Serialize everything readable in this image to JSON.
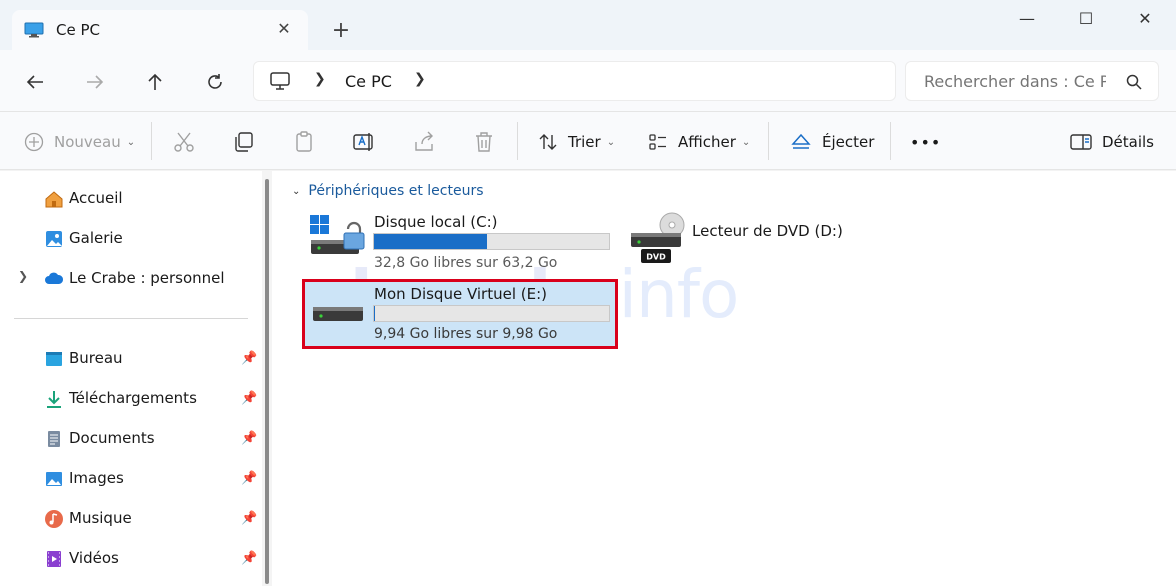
{
  "window": {
    "tab_title": "Ce PC",
    "tab_close": "✕",
    "new_tab": "+",
    "minimize": "—",
    "maximize": "☐",
    "close": "✕"
  },
  "address": {
    "location": "Ce PC",
    "search_placeholder": "Rechercher dans : Ce PC"
  },
  "toolbar": {
    "new_label": "Nouveau",
    "sort_label": "Trier",
    "view_label": "Afficher",
    "eject_label": "Éjecter",
    "more_label": "•••",
    "details_label": "Détails"
  },
  "sidebar": {
    "top_items": [
      {
        "label": "Accueil",
        "icon": "home-icon"
      },
      {
        "label": "Galerie",
        "icon": "gallery-icon"
      },
      {
        "label": "Le Crabe : personnel",
        "icon": "onedrive-cloud-icon"
      }
    ],
    "pinned_items": [
      {
        "label": "Bureau",
        "icon": "desktop-folder-icon"
      },
      {
        "label": "Téléchargements",
        "icon": "download-icon"
      },
      {
        "label": "Documents",
        "icon": "documents-icon"
      },
      {
        "label": "Images",
        "icon": "pictures-icon"
      },
      {
        "label": "Musique",
        "icon": "music-icon"
      },
      {
        "label": "Vidéos",
        "icon": "videos-icon"
      }
    ]
  },
  "main": {
    "group_title": "Périphériques et lecteurs",
    "drives": [
      {
        "name": "Disque local (C:)",
        "free_text": "32,8 Go libres sur 63,2 Go",
        "used_fraction": 0.48,
        "icon": "windows-system-drive-icon"
      },
      {
        "name": "Lecteur de DVD (D:)",
        "icon": "dvd-drive-icon",
        "badge": "DVD"
      },
      {
        "name": "Mon Disque Virtuel (E:)",
        "free_text": "9,94 Go libres sur 9,98 Go",
        "used_fraction": 0.004,
        "icon": "hard-drive-icon",
        "selected": true
      }
    ],
    "watermark": {
      "part1": "lecrabe",
      "part2": "info"
    }
  },
  "colors": {
    "accent": "#1a6ec7",
    "selection": "#cce4f7",
    "highlight_border": "#d9001b",
    "group_header": "#1a5a9c"
  }
}
